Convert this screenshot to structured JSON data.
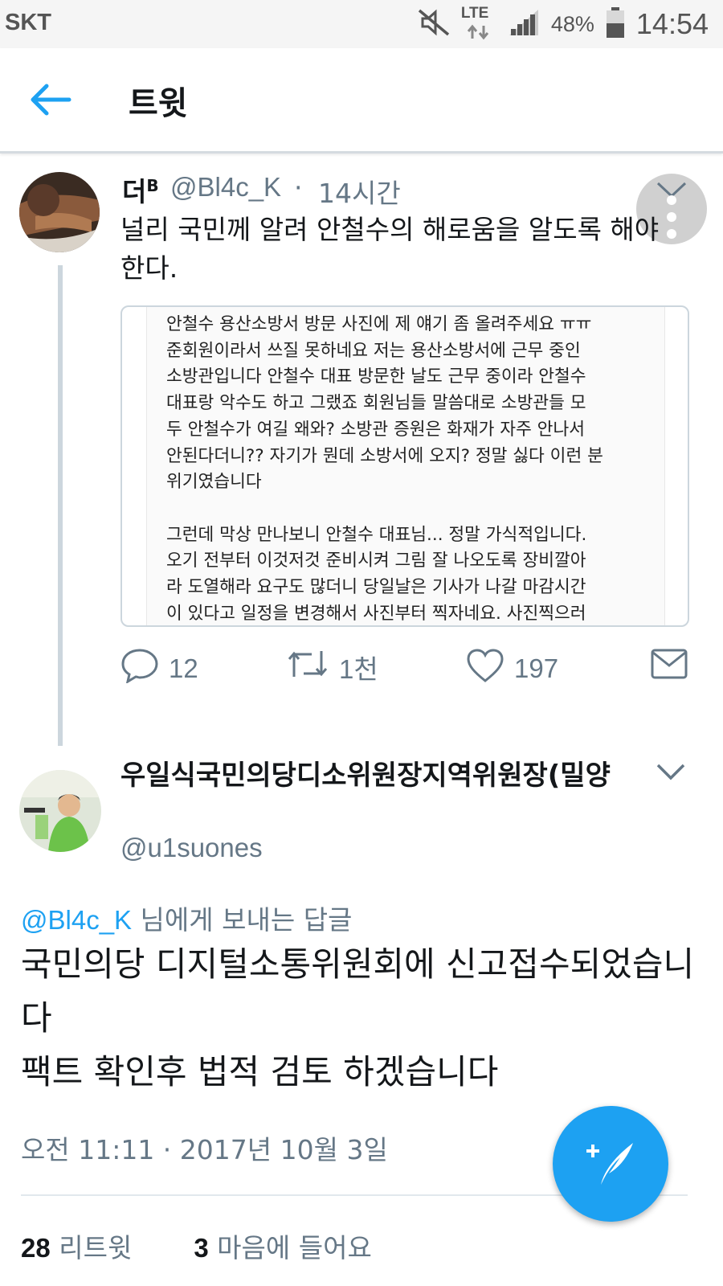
{
  "status_bar": {
    "carrier": "SKT",
    "network": "LTE",
    "battery": "48%",
    "time": "14:54"
  },
  "header": {
    "title": "트윗"
  },
  "tweet1": {
    "name": "더",
    "name_sup": "B",
    "handle": "@Bl4c_K",
    "separator": "·",
    "time": "14시간",
    "text": "널리 국민께 알려 안철수의 해로움을 알도록 해야 한다.",
    "embedded_image_text": "안철수 용산소방서 방문 사진에 제 얘기 좀 올려주세요 ㅠㅠ\n준회원이라서 쓰질 못하네요 저는 용산소방서에 근무 중인\n소방관입니다 안철수 대표 방문한 날도 근무 중이라 안철수\n대표랑 악수도 하고 그랬죠 회원님들 말씀대로 소방관들 모\n두 안철수가 여길 왜와? 소방관 증원은 화재가 자주 안나서\n안된다더니?? 자기가 뭔데 소방서에 오지? 정말 싫다 이런 분\n위기였습니다\n\n그런데 막상 만나보니 안철수 대표님... 정말 가식적입니다.\n오기 전부터 이것저것 준비시켜 그림 잘 나오도록 장비깔아\n라 도열해라 요구도 많더니 당일날은 기사가 나갈 마감시간\n이 있다고 일정을 변경해서 사진부터 찍자네요. 사진찍으러",
    "replies": "12",
    "retweets": "1천",
    "likes": "197"
  },
  "tweet2": {
    "name": "우일식국민의당디소위원장지역위원장(밀양",
    "handle": "@u1suones",
    "reply_mention": "@Bl4c_K",
    "reply_suffix": " 님에게 보내는 답글",
    "text_line1": "국민의당 디지털소통위원회에 신고접수되었습니다",
    "text_line2": "팩트 확인후 법적 검토 하겠습니다",
    "date": "오전 11:11 · 2017년 10월 3일",
    "retweet_count": "28",
    "retweet_label": "리트윗",
    "like_count": "3",
    "like_label": "마음에 들어요"
  },
  "icons": {
    "back": "arrow-left-icon",
    "reply": "speech-bubble-icon",
    "retweet": "retweet-icon",
    "like": "heart-icon",
    "dm": "envelope-icon",
    "compose": "compose-feather-icon"
  },
  "colors": {
    "accent": "#1da1f2",
    "secondary_text": "#657786",
    "primary_text": "#14171a"
  }
}
